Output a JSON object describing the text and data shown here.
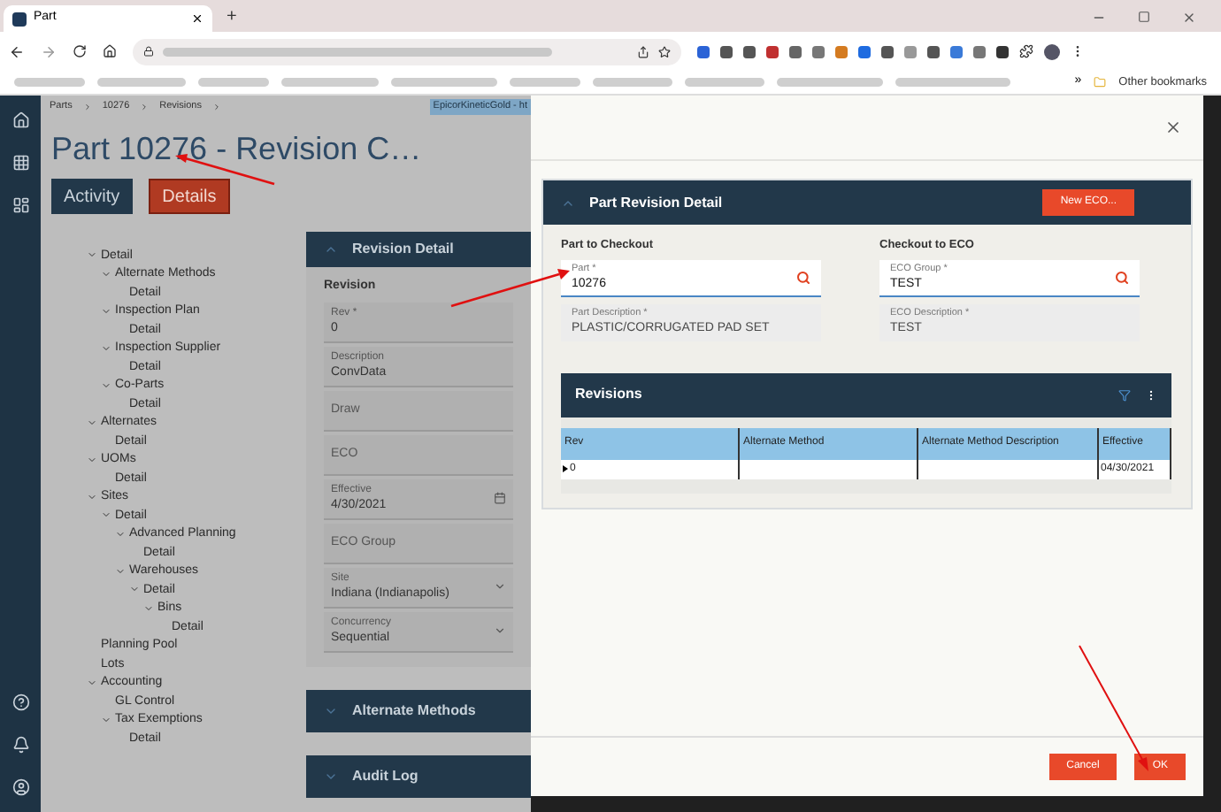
{
  "browser": {
    "tab_title": "Part",
    "new_tab": "+",
    "other_bookmarks": "Other bookmarks",
    "bookmarks_more": "»"
  },
  "breadcrumb": [
    "Parts",
    "10276",
    "Revisions"
  ],
  "env_tag": "EpicorKineticGold - ht",
  "page_title": "Part 10276 - Revision C…",
  "tabs": [
    {
      "label": "Activity",
      "selected": false
    },
    {
      "label": "Details",
      "selected": true
    }
  ],
  "tree": [
    {
      "label": "Detail",
      "expanded": true,
      "children": [
        {
          "label": "Alternate Methods",
          "expanded": true,
          "children": [
            {
              "label": "Detail"
            }
          ]
        },
        {
          "label": "Inspection Plan",
          "expanded": true,
          "children": [
            {
              "label": "Detail"
            }
          ]
        },
        {
          "label": "Inspection Supplier",
          "expanded": true,
          "children": [
            {
              "label": "Detail"
            }
          ]
        },
        {
          "label": "Co-Parts",
          "expanded": true,
          "children": [
            {
              "label": "Detail"
            }
          ]
        }
      ]
    },
    {
      "label": "Alternates",
      "expanded": true,
      "children": [
        {
          "label": "Detail"
        }
      ]
    },
    {
      "label": "UOMs",
      "expanded": true,
      "children": [
        {
          "label": "Detail"
        }
      ]
    },
    {
      "label": "Sites",
      "expanded": true,
      "children": [
        {
          "label": "Detail",
          "expanded": true,
          "children": [
            {
              "label": "Advanced Planning",
              "expanded": true,
              "children": [
                {
                  "label": "Detail"
                }
              ]
            },
            {
              "label": "Warehouses",
              "expanded": true,
              "children": [
                {
                  "label": "Detail",
                  "expanded": true,
                  "children": [
                    {
                      "label": "Bins",
                      "expanded": true,
                      "children": [
                        {
                          "label": "Detail"
                        }
                      ]
                    }
                  ]
                }
              ]
            }
          ]
        }
      ]
    },
    {
      "label": "Planning Pool"
    },
    {
      "label": "Lots"
    },
    {
      "label": "Accounting",
      "expanded": true,
      "children": [
        {
          "label": "GL Control"
        },
        {
          "label": "Tax Exemptions",
          "expanded": true,
          "children": [
            {
              "label": "Detail"
            }
          ]
        }
      ]
    }
  ],
  "revision_panel": {
    "title": "Revision Detail",
    "expanded": true,
    "section": "Revision",
    "fields": [
      {
        "kind": "text",
        "label": "Rev *",
        "value": "0"
      },
      {
        "kind": "text",
        "label": "Description",
        "value": "ConvData"
      },
      {
        "kind": "text",
        "placeholder": "Draw"
      },
      {
        "kind": "text",
        "placeholder": "ECO"
      },
      {
        "kind": "date",
        "label": "Effective",
        "value": "4/30/2021"
      },
      {
        "kind": "text",
        "placeholder": "ECO Group"
      },
      {
        "kind": "select",
        "label": "Site",
        "value": "Indiana (Indianapolis)"
      },
      {
        "kind": "select",
        "label": "Concurrency",
        "value": "Sequential"
      }
    ]
  },
  "collapsed_panels": [
    {
      "title": "Alternate Methods",
      "expanded": false
    },
    {
      "title": "Audit Log",
      "expanded": false
    }
  ],
  "dialog": {
    "panel_title": "Part Revision Detail",
    "expanded": true,
    "new_button": "New ECO...",
    "columns": [
      {
        "heading": "Part to Checkout",
        "fields": [
          {
            "kind": "lookup",
            "label": "Part *",
            "value": "10276",
            "disabled": false
          },
          {
            "kind": "text",
            "label": "Part Description *",
            "value": "PLASTIC/CORRUGATED PAD SET",
            "disabled": true
          }
        ]
      },
      {
        "heading": "Checkout to ECO",
        "fields": [
          {
            "kind": "lookup",
            "label": "ECO Group *",
            "value": "TEST",
            "disabled": false
          },
          {
            "kind": "text",
            "label": "ECO Description *",
            "value": "TEST",
            "disabled": true
          }
        ]
      }
    ],
    "grid": {
      "title": "Revisions",
      "columns": [
        "Rev",
        "Alternate Method",
        "Alternate Method Description",
        "Effective"
      ],
      "rows": [
        [
          "0",
          "",
          "",
          "04/30/2021"
        ]
      ]
    },
    "buttons": [
      "Cancel",
      "OK"
    ]
  }
}
